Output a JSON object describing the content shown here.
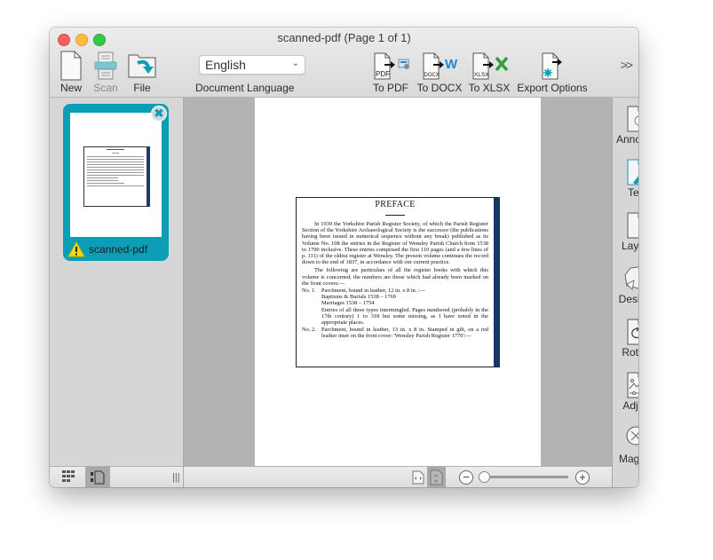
{
  "window": {
    "title": "scanned-pdf (Page 1 of 1)"
  },
  "toolbar": {
    "new_label": "New",
    "scan_label": "Scan",
    "file_label": "File",
    "language_value": "English",
    "language_label": "Document Language",
    "to_pdf_label": "To PDF",
    "to_pdf_badge": "PDF",
    "to_docx_label": "To DOCX",
    "to_docx_badge": "DOCX",
    "to_xlsx_label": "To XLSX",
    "to_xlsx_badge": "XLSX",
    "export_options_label": "Export Options",
    "more_label": ">>"
  },
  "sidebar": {
    "thumbnails": [
      {
        "name": "scanned-pdf",
        "status": "warning"
      }
    ]
  },
  "document": {
    "title": "PREFACE",
    "paragraph1": "In 1939 the Yorkshire Parish Register Society, of which the Parish Register Section of the Yorkshire Archaeological Society is the successor (the publications having been issued in numerical sequence without any break) published as its Volume No. 108 the entries in the Register of Wensley Parish Church from 1538 to 1700 inclusive. These entries comprised the first 110 pages (and a few lines of p. 111) of the oldest register at Wensley. The present volume continues the record down to the end of 1837, in accordance with our current practice.",
    "paragraph2": "The following are particulars of all the register books with which this volume is concerned; the numbers are those which had already been marked on the front covers:—",
    "items": [
      {
        "no": "No. 1.",
        "lines": [
          "Parchment, bound in leather, 12 in. x 8 in. :—",
          "Baptisms & Burials 1538 – 1769",
          "Marriages 1538 – 1754",
          "Entries of all three types intermingled. Pages numbered (probably in the 17th century) 1 to 318 but some missing, as I have noted in the appropriate places."
        ]
      },
      {
        "no": "No. 2.",
        "lines": [
          "Parchment, bound in leather, 13 in. x 8 in. Stamped in gilt, on a red leather inset on the front cover: 'Wensley Parish Register 1770':—"
        ]
      }
    ]
  },
  "tools": [
    {
      "label": "Annotate",
      "icon": "annotate-icon"
    },
    {
      "label": "Text",
      "icon": "text-edit-icon"
    },
    {
      "label": "Layout",
      "icon": "layout-icon"
    },
    {
      "label": "Deskew",
      "icon": "deskew-icon"
    },
    {
      "label": "Rotate",
      "icon": "rotate-icon"
    },
    {
      "label": "Adjust",
      "icon": "adjust-icon"
    },
    {
      "label": "Magnify",
      "icon": "magnify-icon"
    }
  ],
  "bottombar": {
    "zoom_level": 0.05
  },
  "colors": {
    "accent": "#0c9eb7",
    "word_blue": "#1a8ad4",
    "excel_green": "#2f9e3e",
    "warning_yellow": "#f5d90a"
  }
}
